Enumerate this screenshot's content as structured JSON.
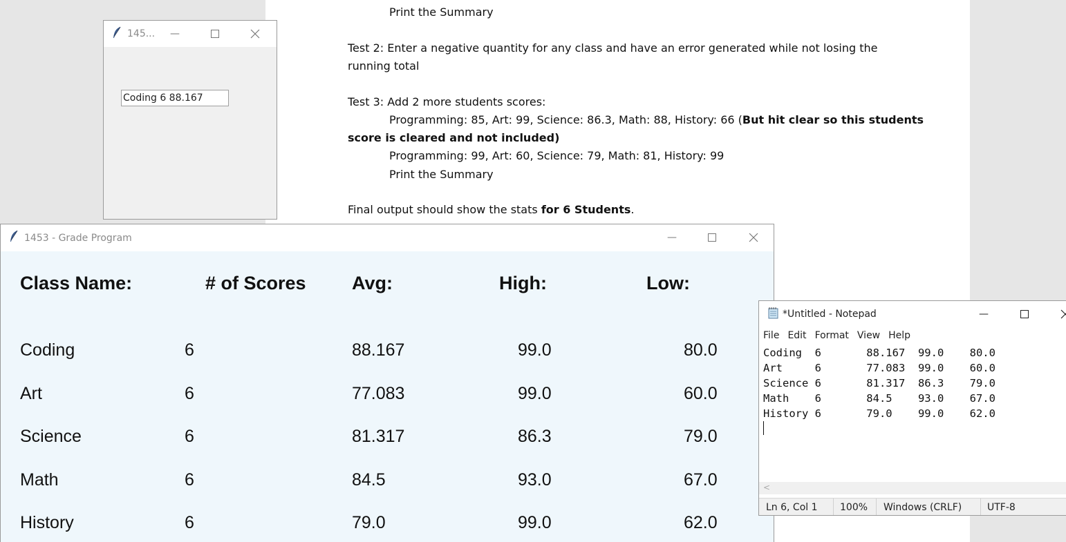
{
  "document": {
    "lines": [
      {
        "text": "Print the Summary",
        "indent": true
      },
      {
        "text": "Test 2: Enter a negative quantity for any class and have an error generated while not losing the"
      },
      {
        "text": "running total"
      },
      {
        "text": "Test 3: Add 2 more students scores:"
      },
      {
        "text": "Programming: 85, Art: 99, Science: 86.3, Math: 88, History: 66 (",
        "bold_tail": "But hit clear so this students",
        "indent": true
      },
      {
        "bold_text": "score is cleared and not included)"
      },
      {
        "text": "Programming: 99, Art: 60, Science: 79, Math: 81, History: 99",
        "indent": true
      },
      {
        "text": "Print the Summary",
        "indent": true
      },
      {
        "text": "Final output should show the stats ",
        "bold_tail": "for 6 Students",
        "tail": "."
      }
    ]
  },
  "small_window": {
    "title": "145...",
    "listbox_text": "Coding  6          88.167"
  },
  "grade_window": {
    "title": "1453 - Grade Program",
    "headers": [
      "Class Name:",
      "# of Scores",
      "Avg:",
      "High:",
      "Low:"
    ],
    "rows": [
      {
        "name": "Coding",
        "count": "6",
        "avg": "88.167",
        "high": "99.0",
        "low": "80.0"
      },
      {
        "name": "Art",
        "count": "6",
        "avg": "77.083",
        "high": "99.0",
        "low": "60.0"
      },
      {
        "name": "Science",
        "count": "6",
        "avg": "81.317",
        "high": "86.3",
        "low": "79.0"
      },
      {
        "name": "Math",
        "count": "6",
        "avg": "84.5",
        "high": "93.0",
        "low": "67.0"
      },
      {
        "name": "History",
        "count": "6",
        "avg": "79.0",
        "high": "99.0",
        "low": "62.0"
      }
    ]
  },
  "notepad": {
    "title": "*Untitled - Notepad",
    "menu": [
      "File",
      "Edit",
      "Format",
      "View",
      "Help"
    ],
    "content": "Coding  6       88.167  99.0    80.0\nArt     6       77.083  99.0    60.0\nScience 6       81.317  86.3    79.0\nMath    6       84.5    93.0    67.0\nHistory 6       79.0    99.0    62.0",
    "status": {
      "position": "Ln 6, Col 1",
      "zoom": "100%",
      "line_ending": "Windows (CRLF)",
      "encoding": "UTF-8"
    }
  },
  "icons": {
    "feather": "tk-feather-icon",
    "notepad": "notepad-icon"
  }
}
